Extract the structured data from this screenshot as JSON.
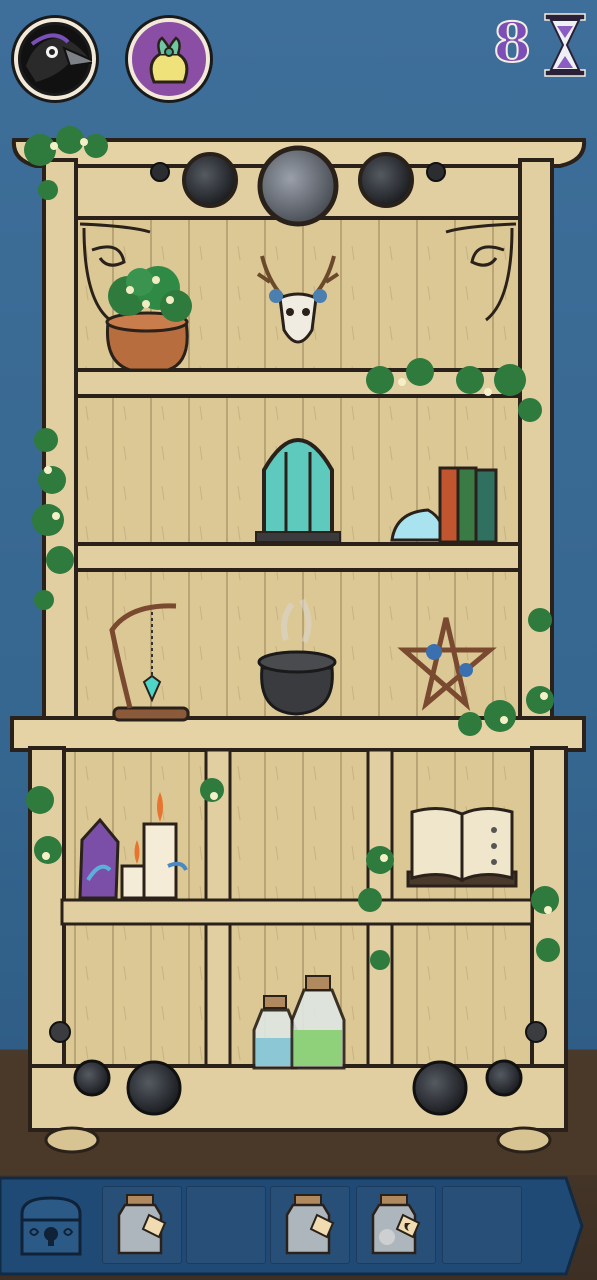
{
  "hud": {
    "moves_remaining": "8",
    "crow_button_icon": "crow-icon",
    "bag_button_icon": "pouch-icon",
    "timer_icon": "hourglass-icon"
  },
  "shelf_items": [
    "plant-pot",
    "deer-skull",
    "terrarium",
    "crystal-stone",
    "books",
    "pendulum-stand",
    "cauldron",
    "pentagram",
    "crystal-cluster",
    "candles",
    "spellbook",
    "potion-bottles"
  ],
  "inventory": {
    "chest_icon": "locked-chest-icon",
    "slots": [
      {
        "filled": true,
        "icon": "jar-with-tag-icon"
      },
      {
        "filled": false
      },
      {
        "filled": true,
        "icon": "jar-with-tag-icon"
      },
      {
        "filled": true,
        "icon": "jar-with-moon-tag-icon"
      },
      {
        "filled": false
      }
    ]
  },
  "colors": {
    "wall": "#3e6f9a",
    "wood": "#e2cfa1",
    "outline": "#2a221a",
    "ivy": "#2f7a3d",
    "inventory_bar": "#1f4a75"
  }
}
